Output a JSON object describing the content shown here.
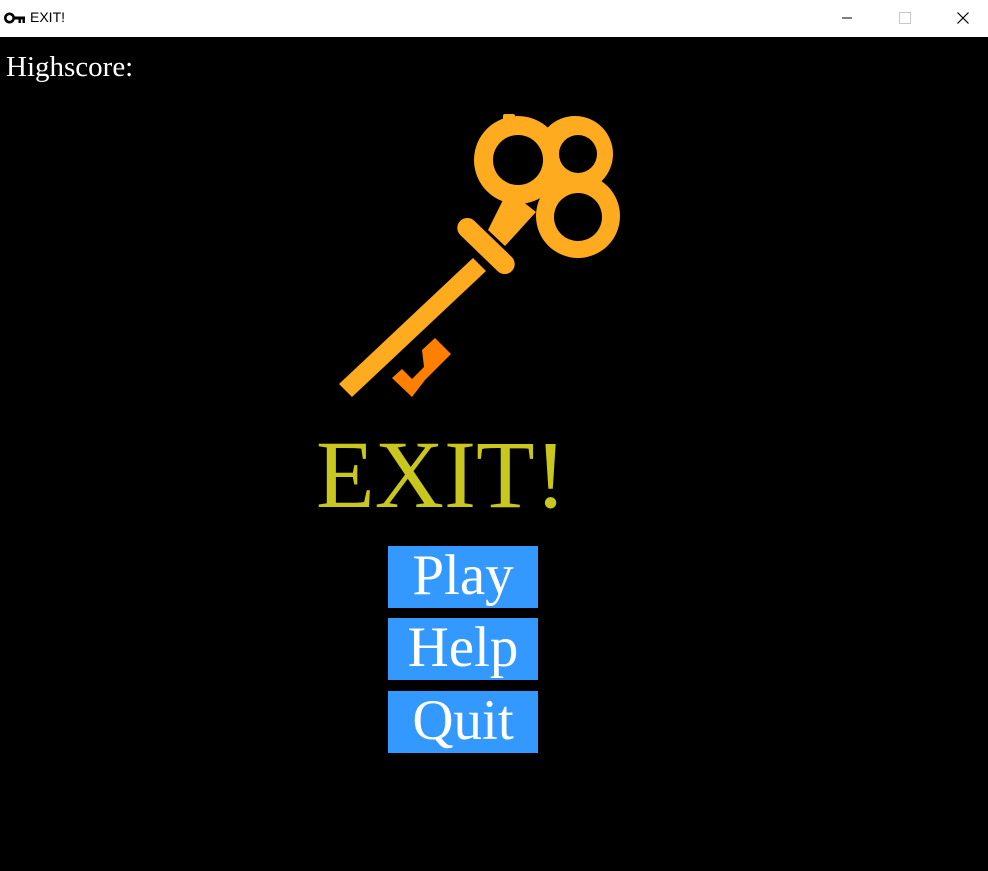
{
  "window": {
    "title": "EXIT!",
    "app_icon": "key-icon",
    "controls": {
      "minimize": "minimize-icon",
      "maximize": "maximize-icon",
      "close": "close-icon"
    }
  },
  "hud": {
    "highscore_label": "Highscore:"
  },
  "logo": {
    "icon": "key-icon",
    "colors": {
      "key": "#ffab1f",
      "bit": "#ff8000"
    }
  },
  "title": {
    "text": "EXIT!",
    "color": "#c9c61d"
  },
  "menu": {
    "button_color": "#3399ff",
    "play_label": "Play",
    "help_label": "Help",
    "quit_label": "Quit"
  }
}
